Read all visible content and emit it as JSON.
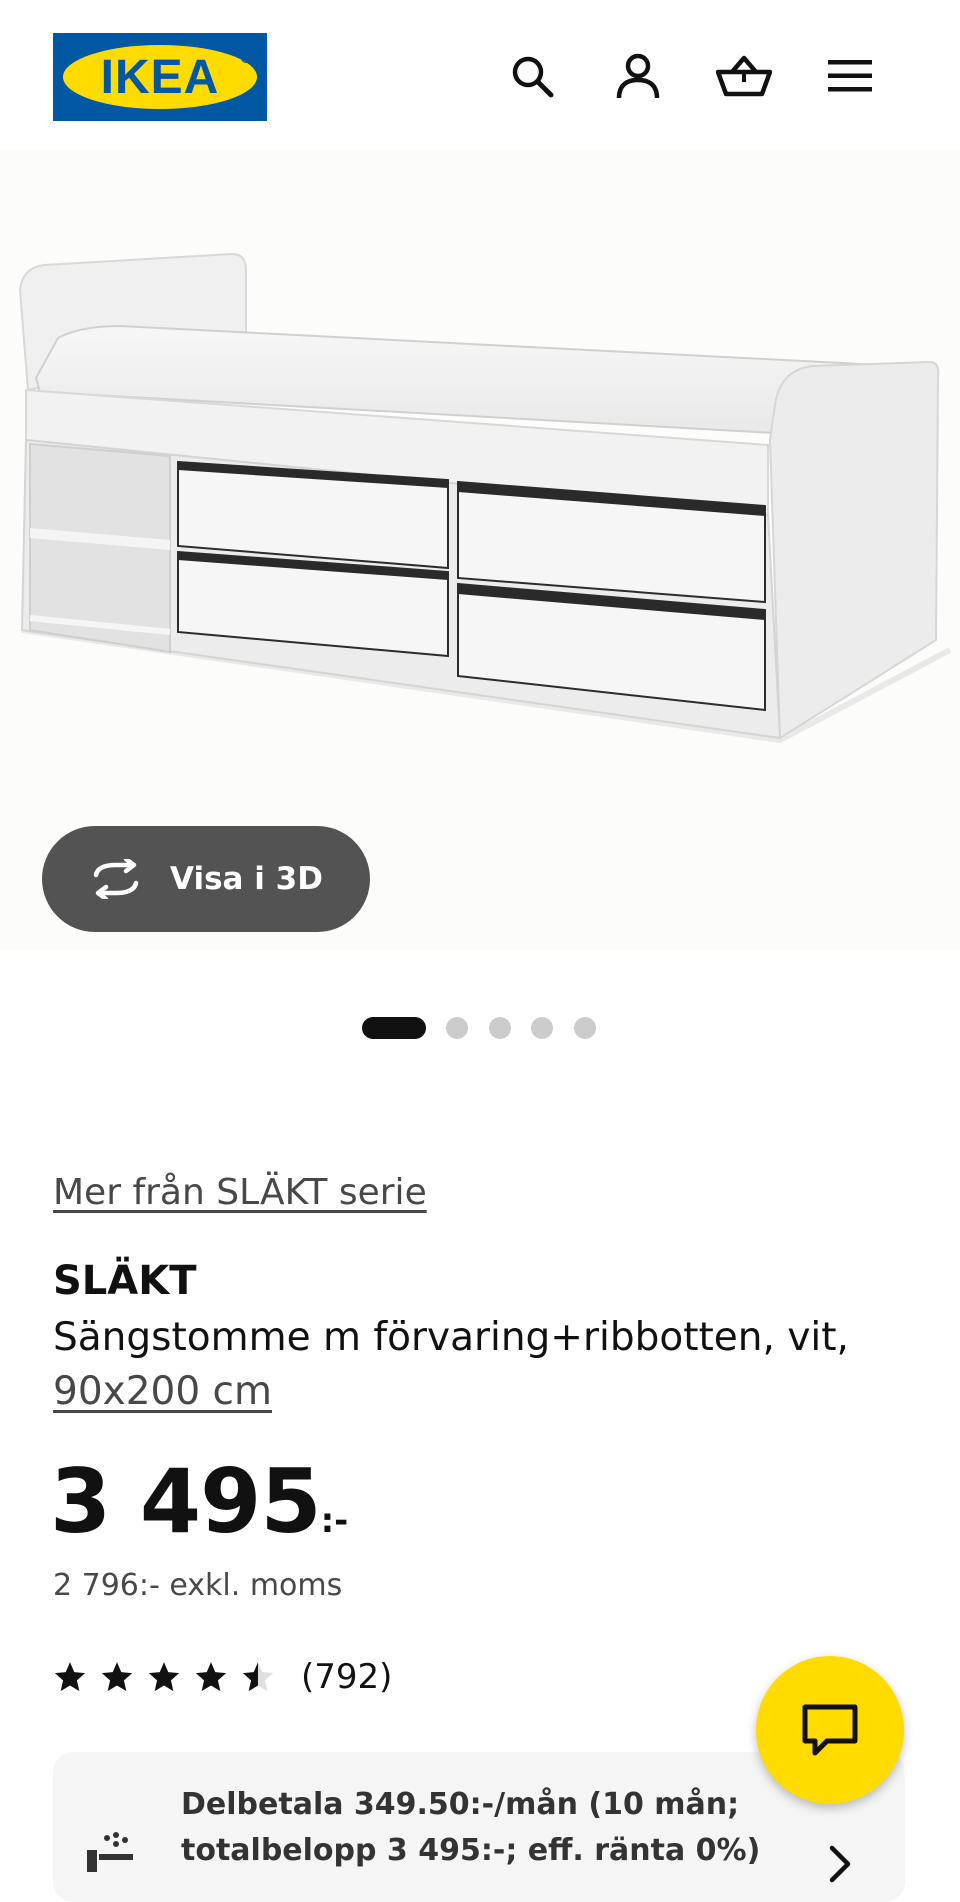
{
  "header": {
    "logo_text": "IKEA",
    "icons": [
      "search-icon",
      "account-icon",
      "cart-icon",
      "menu-icon"
    ]
  },
  "gallery": {
    "view_3d_label": "Visa i 3D",
    "image_count": 5,
    "active_index": 0
  },
  "product": {
    "series_link": "Mer från SLÄKT serie",
    "name": "SLÄKT",
    "description": "Sängstomme m förvaring+ribbotten, vit,",
    "size": "90x200 cm",
    "price": "3 495",
    "price_suffix": ":-",
    "price_excl_vat": "2 796:- exkl. moms",
    "rating": 4.5,
    "rating_max": 5,
    "review_count": "(792)"
  },
  "installment": {
    "text": "Delbetala 349.50:-/mån (10 mån; totalbelopp 3 495:-; eff. ränta 0%)"
  },
  "colors": {
    "ikea_blue": "#0058a3",
    "ikea_yellow": "#ffdb00",
    "button_dark": "#535353"
  }
}
